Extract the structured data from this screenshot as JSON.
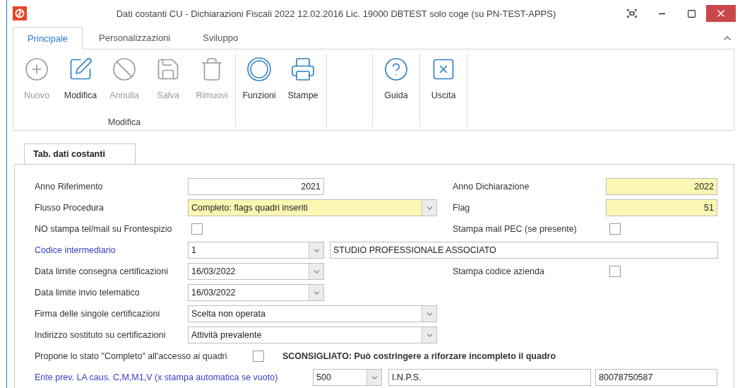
{
  "window": {
    "title": "Dati costanti CU - Dichiarazioni Fiscali 2022 12.02.2016 Lic. 19000 DBTEST solo coge (su PN-TEST-APPS)"
  },
  "ribbon": {
    "tabs": [
      {
        "label": "Principale",
        "selected": true
      },
      {
        "label": "Personalizzazioni",
        "selected": false
      },
      {
        "label": "Sviluppo",
        "selected": false
      }
    ],
    "groups": [
      {
        "label": "Modifica",
        "buttons": [
          {
            "label": "Nuovo",
            "kind": "add",
            "disabled": true
          },
          {
            "label": "Modifica",
            "kind": "edit",
            "disabled": false
          },
          {
            "label": "Annulla",
            "kind": "cancel",
            "disabled": true
          },
          {
            "label": "Salva",
            "kind": "save",
            "disabled": true
          },
          {
            "label": "Rimuovi",
            "kind": "delete",
            "disabled": true
          }
        ]
      },
      {
        "buttons": [
          {
            "label": "Funzioni",
            "kind": "functions",
            "disabled": false
          },
          {
            "label": "Stampe",
            "kind": "print",
            "disabled": false
          }
        ]
      },
      {
        "buttons": [
          {
            "label": "Guida",
            "kind": "help",
            "disabled": false
          }
        ]
      },
      {
        "buttons": [
          {
            "label": "Uscita",
            "kind": "exit",
            "disabled": false
          }
        ]
      }
    ]
  },
  "form": {
    "tab": {
      "label": "Tab. dati costanti"
    },
    "rows": [
      {
        "kind": "pair",
        "left": {
          "label": "Anno Riferimento",
          "link": false,
          "control": {
            "kind": "number",
            "value": "2021",
            "highlighted": false
          }
        },
        "right": {
          "label": "Anno Dichiarazione",
          "control": {
            "kind": "number",
            "value": "2022",
            "highlighted": true
          }
        }
      },
      {
        "kind": "pair",
        "left": {
          "label": "Flusso Procedura",
          "link": false,
          "control": {
            "kind": "long_combo",
            "value": "Completo: flags quadri inseriti",
            "highlighted": true
          }
        },
        "right": {
          "label": "Flag",
          "control": {
            "kind": "number",
            "value": "51",
            "highlighted": true
          }
        }
      },
      {
        "kind": "pair",
        "left": {
          "label": "NO stampa tel/mail su Frontespizio",
          "link": false,
          "control": {
            "kind": "checkbox",
            "checked": false
          }
        },
        "right": {
          "label": "Stampa mail PEC (se presente)",
          "control": {
            "kind": "checkbox",
            "checked": false
          }
        }
      },
      {
        "kind": "pair",
        "left": {
          "label": "Codice intermediario",
          "link": true,
          "control": {
            "kind": "lookup",
            "value": "1",
            "description": "STUDIO PROFESSIONALE ASSOCIATO",
            "highlighted": false
          }
        }
      },
      {
        "kind": "pair",
        "left": {
          "label": "Data limite consegna certificazioni",
          "link": false,
          "control": {
            "kind": "combo",
            "value": "16/03/2022",
            "highlighted": false
          }
        },
        "right": {
          "label": "Stampa codice azienda",
          "control": {
            "kind": "checkbox",
            "checked": false
          }
        }
      },
      {
        "kind": "pair",
        "left": {
          "label": "Data limite invio telematico",
          "link": false,
          "control": {
            "kind": "combo",
            "value": "16/03/2022",
            "highlighted": false
          }
        }
      },
      {
        "kind": "pair",
        "left": {
          "label": "Firma delle singole certificazioni",
          "link": false,
          "control": {
            "kind": "long_combo",
            "value": "Scelta non operata",
            "highlighted": false
          }
        }
      },
      {
        "kind": "pair",
        "left": {
          "label": "Indirizzo sostituto su certificazioni",
          "link": false,
          "control": {
            "kind": "long_combo",
            "value": "Attività prevalente",
            "highlighted": false
          }
        }
      },
      {
        "kind": "check_note",
        "label": "Propone lo stato \"Completo\" all'accesso ai quadri",
        "checked": false,
        "note": "SCONSIGLIATO: Può costringere a riforzare incompleto il quadro"
      },
      {
        "kind": "code_lookup",
        "label": "Ente prev. LA caus. C,M,M1,V (x stampa automatica se vuoto)",
        "link": true,
        "code": "500",
        "name": "I.N.P.S.",
        "tax_code": "80078750587"
      }
    ]
  }
}
